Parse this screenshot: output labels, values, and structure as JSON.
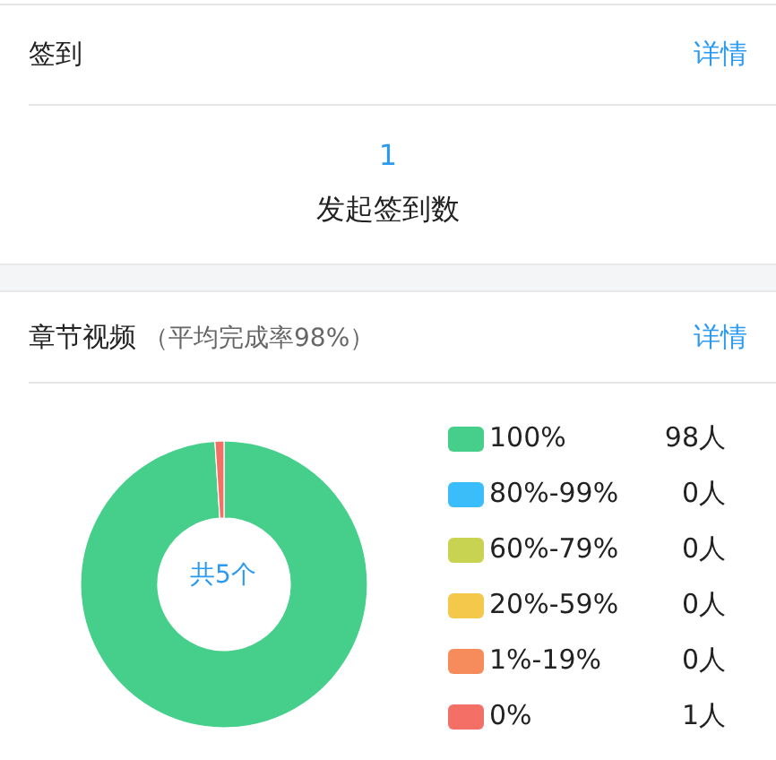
{
  "signin": {
    "title": "签到",
    "detail_link": "详情",
    "count": "1",
    "count_label": "发起签到数"
  },
  "video": {
    "title": "章节视频",
    "subtitle": "（平均完成率98%）",
    "detail_link": "详情",
    "center_label": "共5个",
    "chart_data": {
      "type": "donut",
      "categories": [
        "100%",
        "80%-99%",
        "60%-79%",
        "20%-59%",
        "1%-19%",
        "0%"
      ],
      "values": [
        98,
        0,
        0,
        0,
        0,
        1
      ]
    },
    "legend": [
      {
        "count": "98人",
        "color": "#46cf8a"
      },
      {
        "count": "0人",
        "color": "#3bbdf9"
      },
      {
        "count": "0人",
        "color": "#c8d451"
      },
      {
        "count": "0人",
        "color": "#f4c84a"
      },
      {
        "count": "0人",
        "color": "#f68b5b"
      },
      {
        "count": "1人",
        "color": "#f46f66"
      }
    ]
  }
}
